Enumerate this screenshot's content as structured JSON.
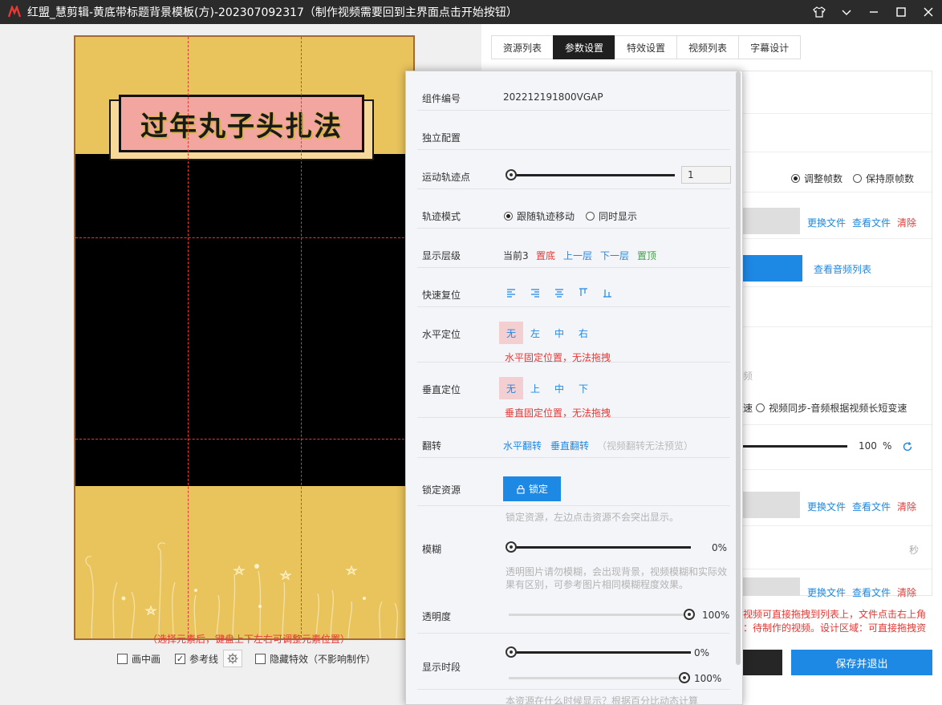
{
  "window": {
    "title": "红盟_慧剪辑-黄底带标题背景模板(方)-202307092317（制作视频需要回到主界面点击开始按钮）",
    "icons": [
      "shirt-icon",
      "chevron-down-icon",
      "minimize-icon",
      "maximize-icon",
      "close-icon"
    ]
  },
  "canvas": {
    "title_text": "过年丸子头扎法",
    "bg_color": "#e9c35c",
    "hint": "（选择元素后，键盘上下左右可调整元素位置）",
    "options": {
      "pip_label": "画中画",
      "pip_checked": false,
      "guides_label": "参考线",
      "guides_checked": true,
      "hide_effects_label": "隐藏特效（不影响制作）",
      "hide_effects_checked": false
    }
  },
  "tabs": [
    {
      "label": "资源列表",
      "active": false
    },
    {
      "label": "参数设置",
      "active": true
    },
    {
      "label": "特效设置",
      "active": false
    },
    {
      "label": "视频列表",
      "active": false
    },
    {
      "label": "字幕设计",
      "active": false
    }
  ],
  "background_panel": {
    "frame_opt_1": "调整帧数",
    "frame_opt_2": "保持原帧数",
    "replace_file": "更换文件",
    "view_file": "查看文件",
    "clear": "清除",
    "view_audio_list": "查看音频列表",
    "frag_text": "频",
    "sync_frag": "速",
    "sync_option": "视频同步-音频根据视频长短变速",
    "volume_value": "100",
    "volume_unit": "%",
    "seconds_unit": "秒",
    "bottom_msg_1": "视频可直接拖拽到列表上，文件点击右上角",
    "bottom_msg_2": "：待制作的视频。设计区域：可直接拖拽资",
    "save_exit": "保存并退出"
  },
  "popup": {
    "component_id_label": "组件编号",
    "component_id": "202212191800VGAP",
    "independent_label": "独立配置",
    "motion_label": "运动轨迹点",
    "motion_value": "1",
    "trajectory_label": "轨迹模式",
    "trajectory_opt_1": "跟随轨迹移动",
    "trajectory_opt_2": "同时显示",
    "layer_label": "显示层级",
    "layer_current": "当前3",
    "layer_bottom": "置底",
    "layer_up": "上一层",
    "layer_down": "下一层",
    "layer_top": "置顶",
    "quick_reset_label": "快速复位",
    "quick_reset_icons": [
      "align-left-icon",
      "align-right-icon",
      "align-center-icon",
      "align-top-icon",
      "align-bottom-icon"
    ],
    "h_pos_label": "水平定位",
    "h_opts": [
      "无",
      "左",
      "中",
      "右"
    ],
    "h_warning": "水平固定位置，无法拖拽",
    "v_pos_label": "垂直定位",
    "v_opts": [
      "无",
      "上",
      "中",
      "下"
    ],
    "v_warning": "垂直固定位置，无法拖拽",
    "flip_label": "翻转",
    "flip_h": "水平翻转",
    "flip_v": "垂直翻转",
    "flip_note": "（视频翻转无法预览）",
    "lock_label": "锁定资源",
    "lock_button": "锁定",
    "lock_note": "锁定资源，左边点击资源不会突出显示。",
    "blur_label": "模糊",
    "blur_value": "0%",
    "blur_note_1": "透明图片请勿模糊，会出现背景，视频模糊和实际效",
    "blur_note_2": "果有区别，可参考图片相同模糊程度效果。",
    "opacity_label": "透明度",
    "opacity_value": "100%",
    "period_label": "显示时段",
    "period_start": "0%",
    "period_end": "100%",
    "period_note": "本资源在什么时候显示？根据百分比动态计算"
  }
}
